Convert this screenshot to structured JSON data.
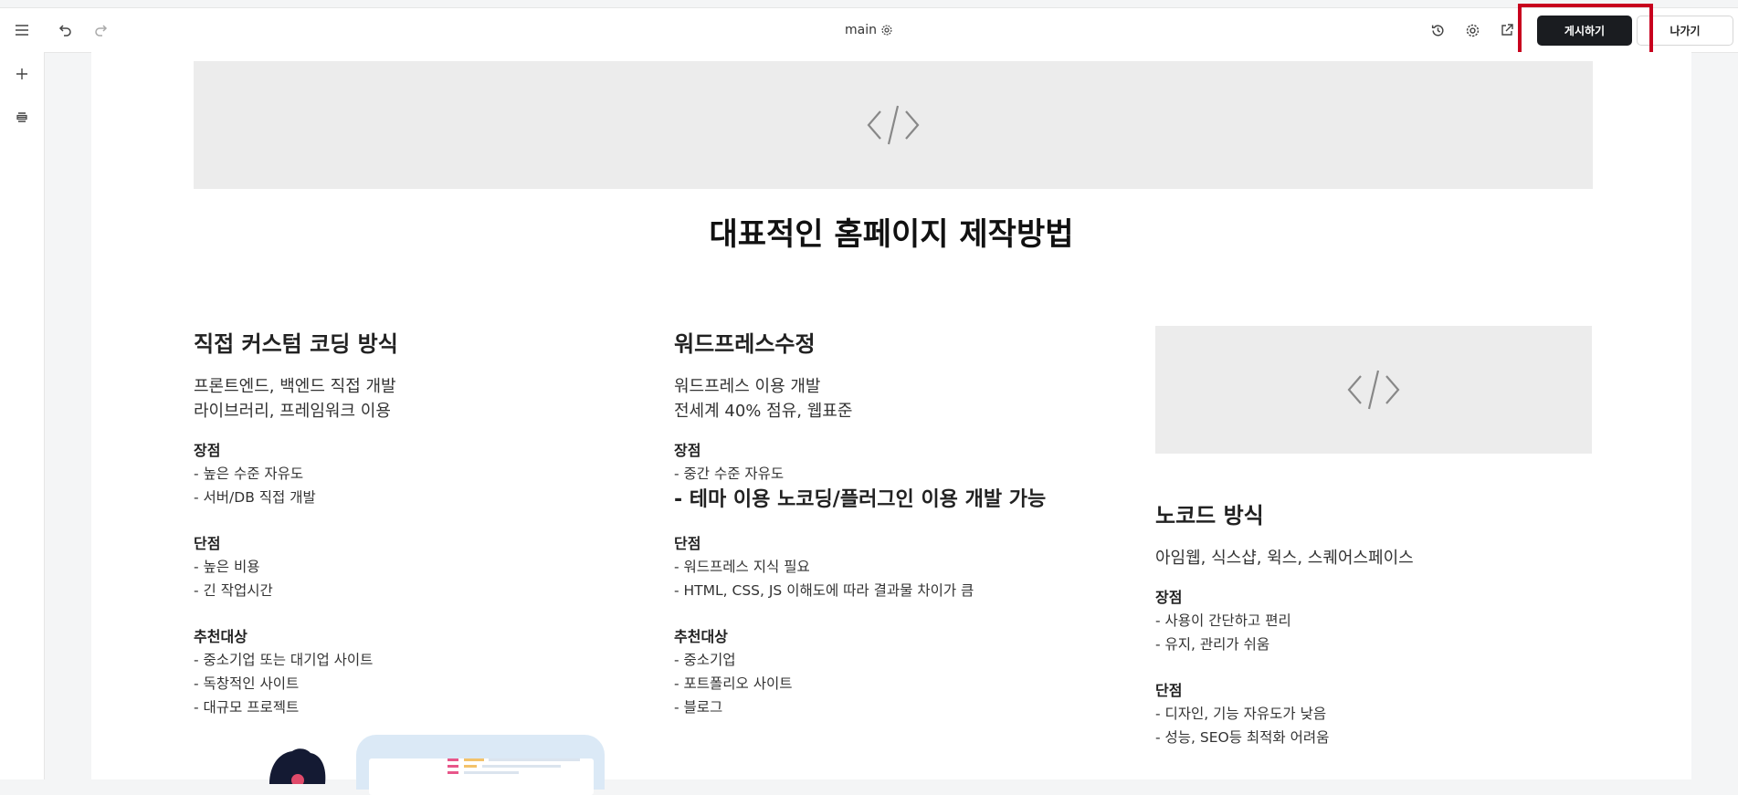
{
  "toolbar": {
    "doc_name": "main",
    "publish_label": "게시하기",
    "exit_label": "나가기"
  },
  "content": {
    "main_title": "대표적인 홈페이지 제작방법",
    "columns": [
      {
        "title": "직접 커스텀 코딩 방식",
        "intro": [
          "프론트엔드, 백엔드 직접 개발",
          "라이브러리, 프레임워크 이용"
        ],
        "sections": [
          {
            "label": "장점",
            "items": [
              "- 높은 수준 자유도",
              "- 서버/DB 직접 개발"
            ]
          },
          {
            "label": "단점",
            "items": [
              "- 높은 비용",
              "- 긴 작업시간"
            ]
          },
          {
            "label": "추천대상",
            "items": [
              "- 중소기업 또는 대기업 사이트",
              "- 독창적인 사이트",
              "- 대규모 프로젝트"
            ]
          }
        ]
      },
      {
        "title": "워드프레스수정",
        "intro": [
          "워드프레스 이용 개발",
          "전세계 40% 점유, 웹표준"
        ],
        "sections": [
          {
            "label": "장점",
            "items": [
              "- 중간 수준 자유도",
              "- 테마 이용 노코딩/플러그인 이용 개발 가능"
            ]
          },
          {
            "label": "단점",
            "items": [
              "- 워드프레스 지식 필요",
              "-  HTML, CSS, JS 이해도에 따라 결과물 차이가 큼"
            ]
          },
          {
            "label": "추천대상",
            "items": [
              "- 중소기업",
              "- 포트폴리오 사이트",
              "- 블로그"
            ]
          }
        ]
      },
      {
        "title": "노코드 방식",
        "intro": [
          "아임웹, 식스샵, 윅스, 스퀘어스페이스"
        ],
        "sections": [
          {
            "label": "장점",
            "items": [
              "- 사용이 간단하고 편리",
              "- 유지, 관리가 쉬움"
            ]
          },
          {
            "label": "단점",
            "items": [
              "- 디자인, 기능 자유도가 낮음",
              "- 성능, SEO등 최적화 어려움"
            ]
          }
        ]
      }
    ]
  },
  "icons": [
    "menu-icon",
    "undo-icon",
    "redo-icon",
    "settings-icon",
    "history-icon",
    "external-link-icon",
    "add-icon",
    "layers-icon",
    "code-placeholder-icon"
  ],
  "colors": {
    "publish_bg": "#1a1c20",
    "highlight": "#c8001e",
    "placeholder": "#ececec"
  }
}
